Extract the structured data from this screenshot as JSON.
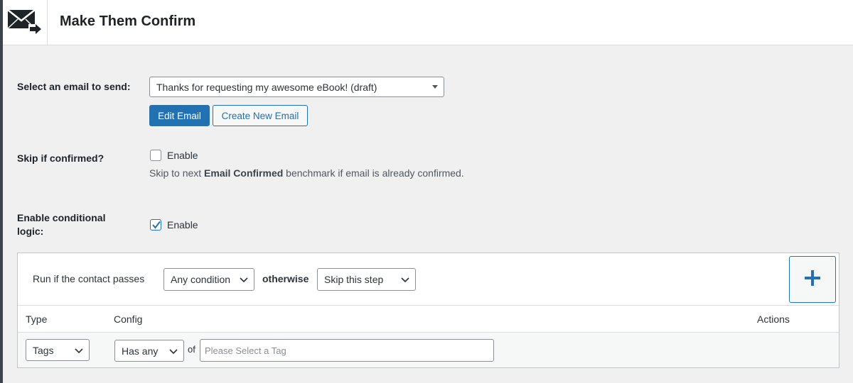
{
  "header": {
    "title": "Make Them Confirm",
    "icon": "mail-forward-icon"
  },
  "email_row": {
    "label": "Select an email to send:",
    "selected": "Thanks for requesting my awesome eBook! (draft)",
    "edit_label": "Edit Email",
    "create_label": "Create New Email"
  },
  "skip_row": {
    "label": "Skip if confirmed?",
    "checkbox_label": "Enable",
    "checked": false,
    "help_prefix": "Skip to next ",
    "help_bold": "Email Confirmed",
    "help_suffix": " benchmark if email is already confirmed."
  },
  "conditional_row": {
    "label": "Enable conditional logic:",
    "checkbox_label": "Enable",
    "checked": true
  },
  "conditions": {
    "run_text": "Run if the contact passes",
    "condition_select": "Any condition",
    "otherwise_text": "otherwise",
    "otherwise_select": "Skip this step",
    "add_symbol": "+",
    "columns": [
      "Type",
      "Config",
      "Actions"
    ],
    "rows": [
      {
        "type": "Tags",
        "operator": "Has any",
        "of_text": "of",
        "placeholder": "Please Select a Tag"
      }
    ]
  },
  "colors": {
    "primary": "#2271b1",
    "background": "#f0f0f1"
  }
}
